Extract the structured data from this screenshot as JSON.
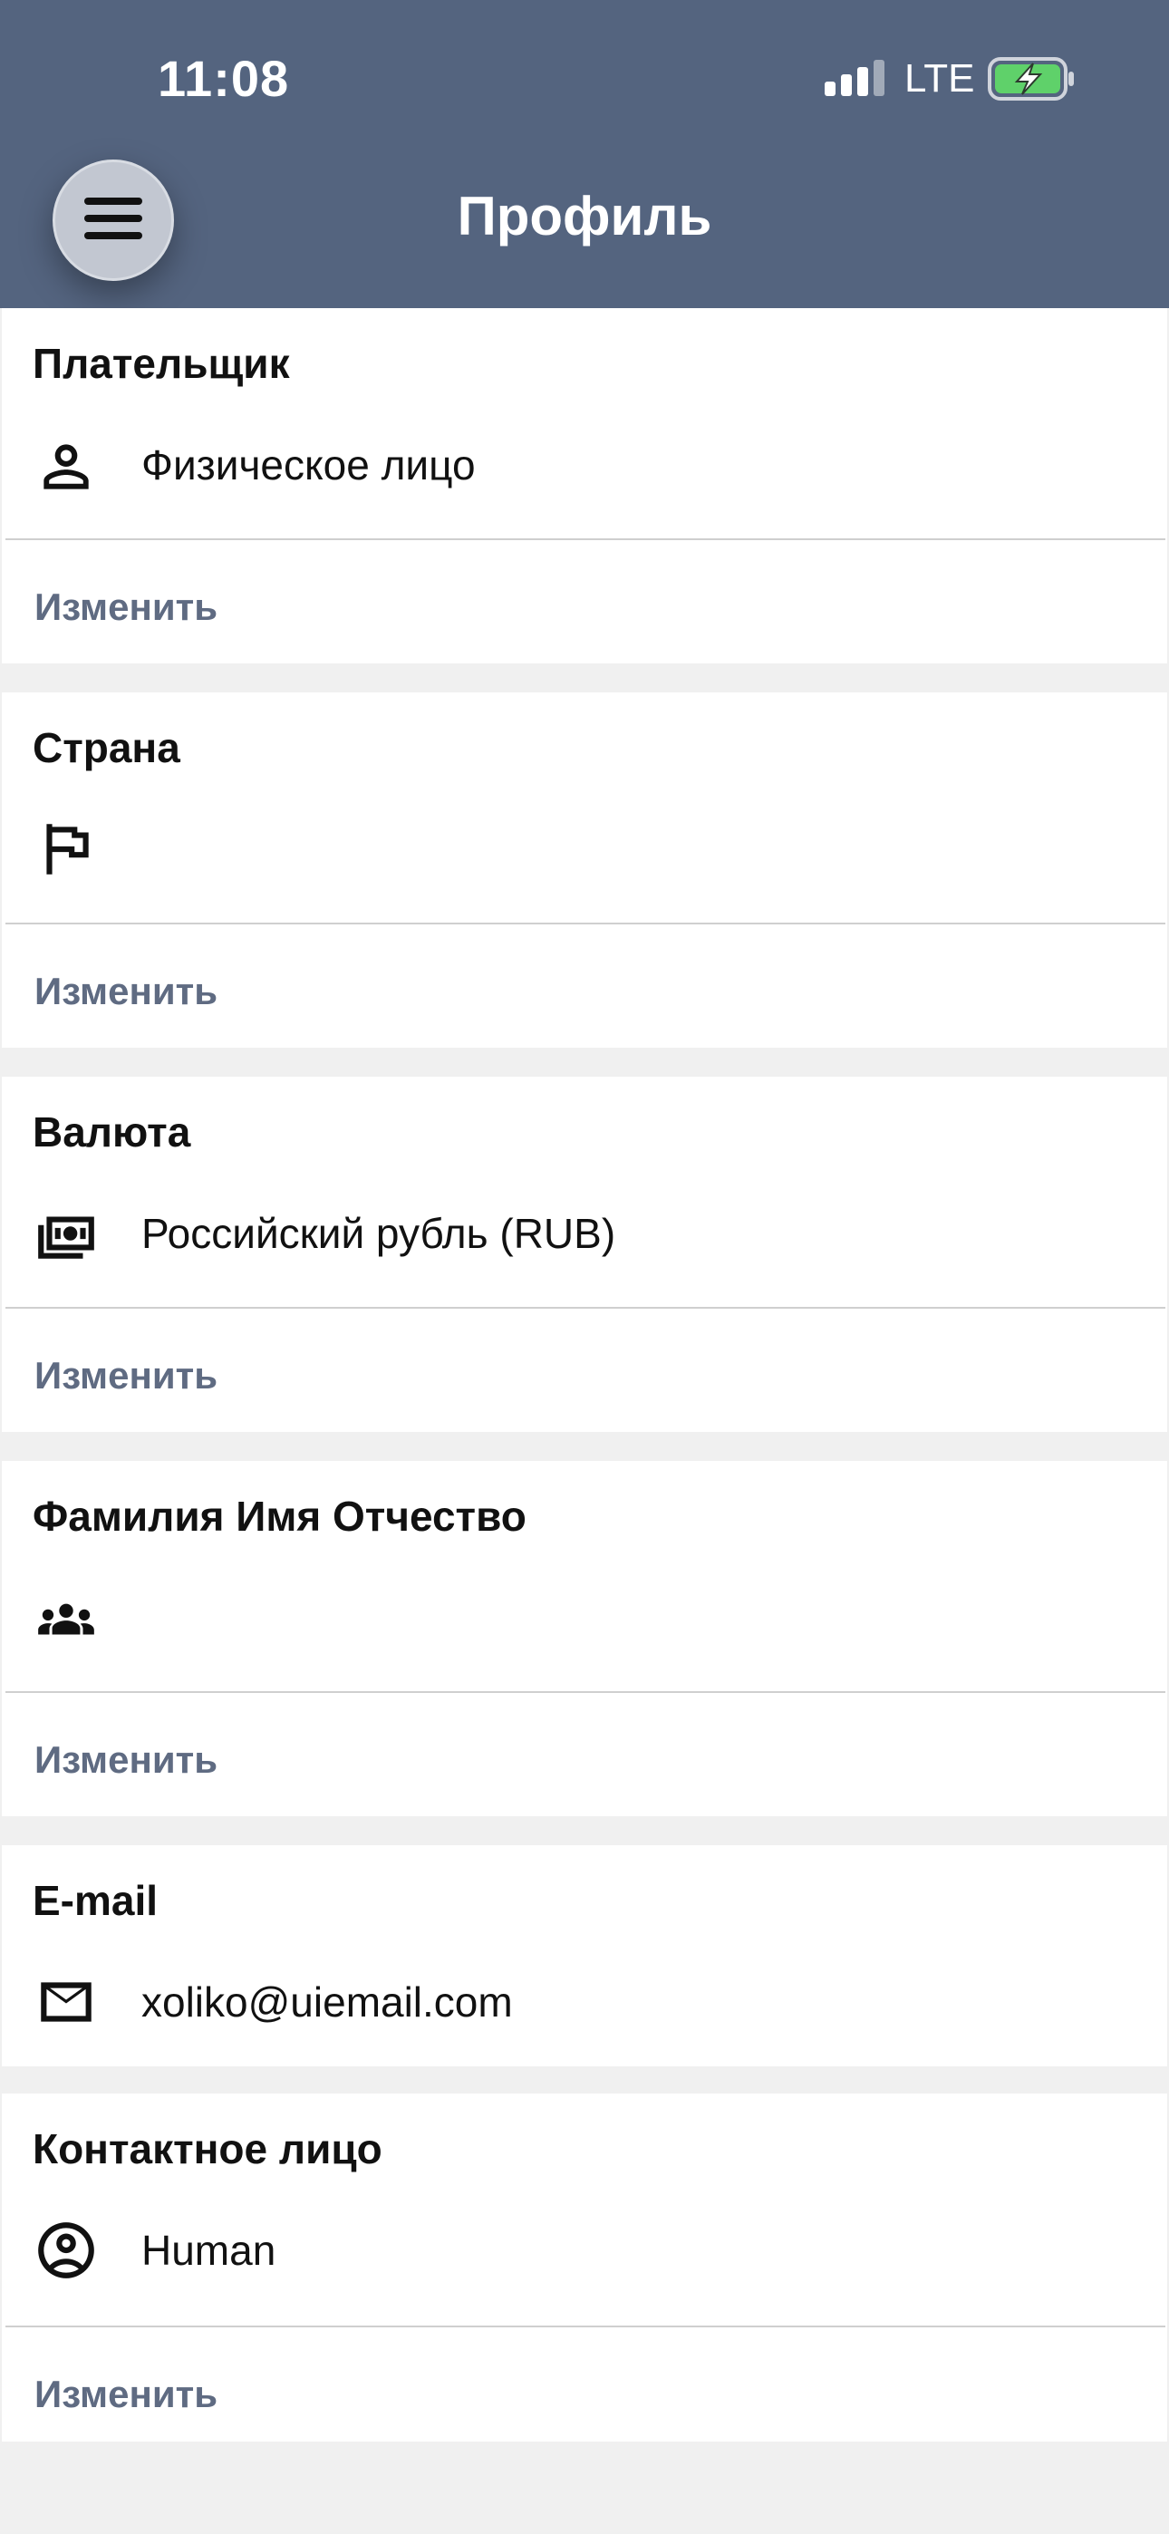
{
  "status_bar": {
    "time": "11:08",
    "network": "LTE",
    "battery_icon": "battery-charging-icon",
    "signal_icon": "signal-bars-icon"
  },
  "header": {
    "title": "Профиль",
    "menu_icon": "hamburger-menu-icon",
    "background_color": "#54647f"
  },
  "sections": [
    {
      "title": "Плательщик",
      "icon": "person-icon",
      "value": "Физическое лицо",
      "action": "Изменить"
    },
    {
      "title": "Страна",
      "icon": "flag-icon",
      "value": "",
      "action": "Изменить"
    },
    {
      "title": "Валюта",
      "icon": "money-icon",
      "value": "Российский рубль (RUB)",
      "action": "Изменить"
    },
    {
      "title": "Фамилия Имя Отчество",
      "icon": "group-icon",
      "value": "",
      "action": "Изменить"
    },
    {
      "title": "E-mail",
      "icon": "envelope-icon",
      "value": "xoliko@uiemail.com"
    },
    {
      "title": "Контактное лицо",
      "icon": "account-circle-icon",
      "value": "Human",
      "action": "Изменить"
    }
  ],
  "colors": {
    "header": "#54647f",
    "link": "#5f6b82",
    "page_background": "#f0f0f0"
  }
}
